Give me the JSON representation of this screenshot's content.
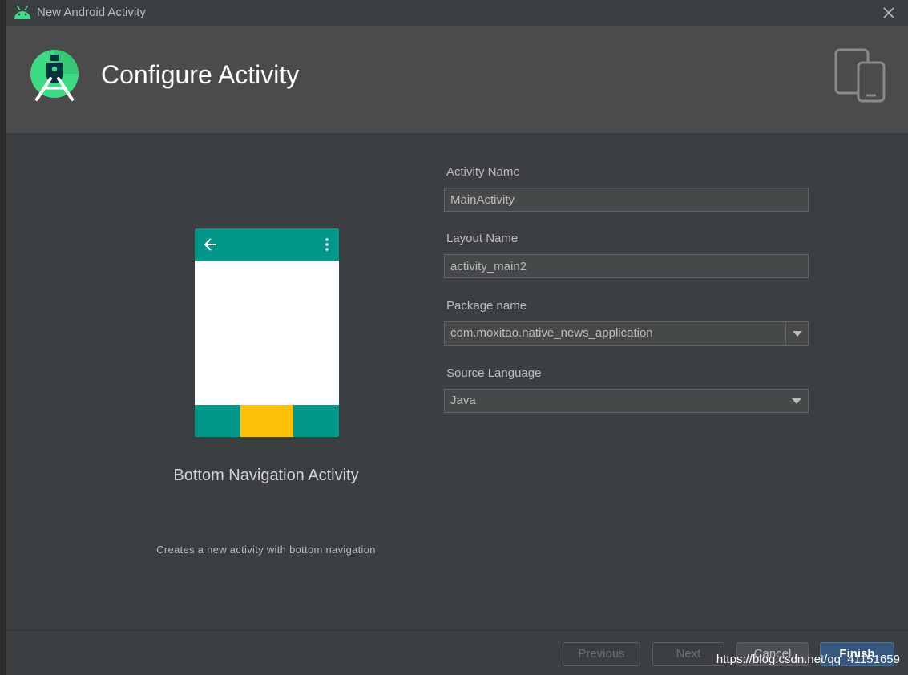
{
  "window": {
    "title": "New Android Activity",
    "icon": "android-icon",
    "close_icon": "close-icon"
  },
  "header": {
    "title": "Configure Activity",
    "logo_icon": "android-studio-logo",
    "devices_icon": "devices-icon"
  },
  "template": {
    "name": "Bottom Navigation Activity",
    "description": "Creates a new activity with bottom navigation",
    "colors": {
      "primary": "#009688",
      "accent": "#ffc107"
    }
  },
  "form": {
    "activity_name": {
      "label": "Activity Name",
      "value": "MainActivity"
    },
    "layout_name": {
      "label": "Layout Name",
      "value": "activity_main2"
    },
    "package_name": {
      "label": "Package name",
      "value": "com.moxitao.native_news_application"
    },
    "source_language": {
      "label": "Source Language",
      "value": "Java"
    }
  },
  "footer": {
    "previous_label": "Previous",
    "next_label": "Next",
    "cancel_label": "Cancel",
    "finish_label": "Finish",
    "watermark": "https://blog.csdn.net/qq_41151659"
  },
  "colors": {
    "dialog_bg": "#3c3f41",
    "header_bg": "#4b4b4b",
    "primary_button": "#365880",
    "android_green": "#3ddc84"
  }
}
